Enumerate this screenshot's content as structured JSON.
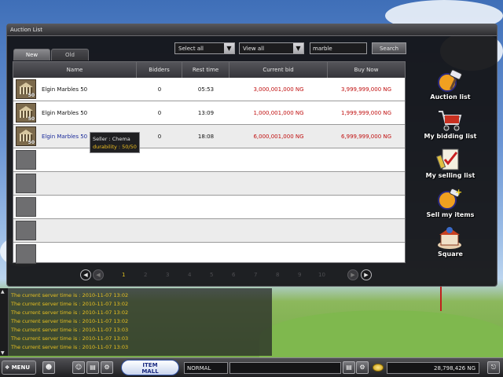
{
  "window": {
    "title": "Auction List"
  },
  "tabs": [
    {
      "label": "New",
      "active": true
    },
    {
      "label": "Old",
      "active": false
    }
  ],
  "filters": {
    "category_select": "Select all",
    "view_select": "View all",
    "search_value": "marble",
    "search_button": "Search"
  },
  "table": {
    "headers": [
      "Name",
      "Bidders",
      "Rest time",
      "Current bid",
      "Buy Now"
    ],
    "rows": [
      {
        "name": "Elgin Marbles 50",
        "bidders": "0",
        "rest_time": "05:53",
        "current_bid": "3,000,001,000 NG",
        "buy_now": "3,999,999,000 NG",
        "qty": "50"
      },
      {
        "name": "Elgin Marbles 50",
        "bidders": "0",
        "rest_time": "13:09",
        "current_bid": "1,000,001,000 NG",
        "buy_now": "1,999,999,000 NG",
        "qty": "50"
      },
      {
        "name": "Elgin Marbles 50",
        "bidders": "0",
        "rest_time": "18:08",
        "current_bid": "6,000,001,000 NG",
        "buy_now": "6,999,999,000 NG",
        "qty": "50"
      }
    ]
  },
  "tooltip": {
    "seller": "Seller : Chema",
    "durability": "durability : 50/50"
  },
  "pagination": {
    "pages": [
      "1",
      "2",
      "3",
      "4",
      "5",
      "6",
      "7",
      "8",
      "9",
      "10"
    ],
    "current": "1"
  },
  "side_menu": [
    {
      "label": "Auction list",
      "icon": "auction-hammer-icon"
    },
    {
      "label": "My bidding list",
      "icon": "shopping-cart-icon"
    },
    {
      "label": "My selling list",
      "icon": "checklist-icon"
    },
    {
      "label": "Sell my items",
      "icon": "sell-coins-icon"
    },
    {
      "label": "Square",
      "icon": "square-building-icon"
    }
  ],
  "chat": {
    "lines": [
      "The current server time is : 2010-11-07 13:02",
      "The current server time is : 2010-11-07 13:02",
      "The current server time is : 2010-11-07 13:02",
      "The current server time is : 2010-11-07 13:02",
      "The current server time is : 2010-11-07 13:03",
      "The current server time is : 2010-11-07 13:03",
      "The current server time is : 2010-11-07 13:03"
    ]
  },
  "bottombar": {
    "menu_label": "MENU",
    "itemmall_line1": "ITEM",
    "itemmall_line2": "MALL",
    "chat_mode": "NORMAL",
    "gold": "28,798,426 NG"
  },
  "colors": {
    "bid_red": "#c01010",
    "tooltip_yellow": "#f0c020",
    "chat_yellow": "#e8c020",
    "current_page": "#e0c020"
  }
}
